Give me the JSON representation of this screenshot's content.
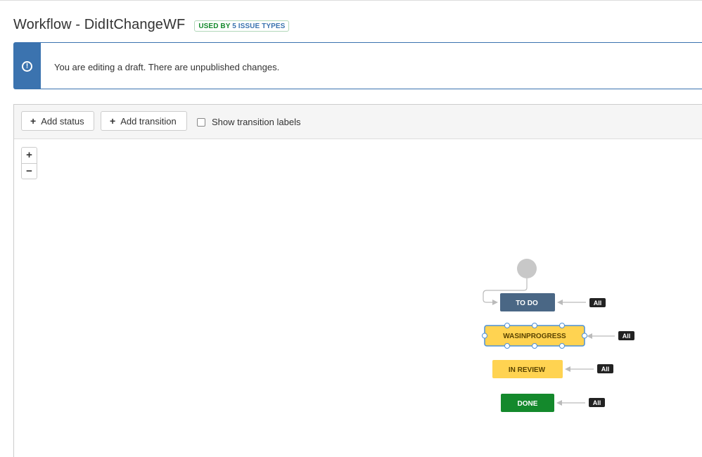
{
  "header": {
    "title": "Workflow - DidItChangeWF",
    "badge_prefix": "USED BY",
    "badge_count": "5",
    "badge_suffix": "ISSUE TYPES"
  },
  "notice": {
    "icon": "info-icon",
    "text": "You are editing a draft. There are unpublished changes."
  },
  "toolbar": {
    "add_status": "Add status",
    "add_transition": "Add transition",
    "show_labels": "Show transition labels",
    "show_labels_checked": false
  },
  "zoom": {
    "in": "+",
    "out": "−"
  },
  "diagram": {
    "statuses": [
      {
        "name": "TO DO",
        "color": "#4a6785",
        "text_color": "#ffffff",
        "selected": false
      },
      {
        "name": "WASINPROGRESS",
        "color": "#ffd351",
        "text_color": "#594300",
        "selected": true
      },
      {
        "name": "IN REVIEW",
        "color": "#ffd351",
        "text_color": "#594300",
        "selected": false
      },
      {
        "name": "DONE",
        "color": "#14892c",
        "text_color": "#ffffff",
        "selected": false
      }
    ],
    "global_transition_label": "All"
  }
}
